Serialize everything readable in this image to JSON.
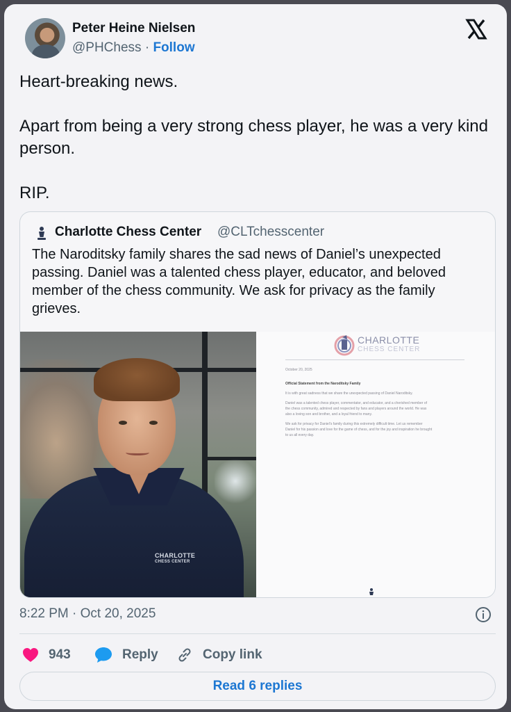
{
  "author": {
    "name": "Peter Heine Nielsen",
    "handle": "@PHChess",
    "separator": "·",
    "follow_label": "Follow"
  },
  "tweet": {
    "paragraphs": [
      "Heart-breaking news.",
      "Apart from being a very strong chess player, he was a very kind person.",
      "RIP."
    ],
    "timestamp": "8:22 PM · Oct 20, 2025"
  },
  "quote": {
    "name": "Charlotte Chess Center",
    "handle": "@CLTchesscenter",
    "text": "The Naroditsky family shares the sad news of Daniel’s unexpected passing. Daniel was a talented chess player, educator, and beloved member of the chess community. We ask for privacy as the family grieves.",
    "shirt_logo": [
      "CHARLOTTE",
      "CHESS CENTER"
    ],
    "document": {
      "logo_line1": "CHARLOTTE",
      "logo_line2": "CHESS CENTER",
      "date": "October 20, 2025",
      "heading": "Official Statement from the Naroditsky Family",
      "lines": [
        "It is with great sadness that we share the unexpected passing of Daniel Naroditsky.",
        "Daniel was a talented chess player, commentator, and educator, and a cherished member of",
        "the chess community, admired and respected by fans and players around the world. He was",
        "also a loving son and brother, and a loyal friend to many.",
        "We ask for privacy for Daniel’s family during this extremely difficult time. Let us remember",
        "Daniel for his passion and love for the game of chess, and for the joy and inspiration he brought",
        "to us all every day."
      ]
    }
  },
  "actions": {
    "likes": "943",
    "reply_label": "Reply",
    "copy_label": "Copy link",
    "read_replies_label": "Read 6 replies"
  },
  "colors": {
    "accent": "#1d77d2",
    "like": "#f91880",
    "muted": "#536471",
    "text": "#0f1419"
  },
  "icons": [
    "x-logo-icon",
    "chess-logo-icon",
    "info-icon",
    "heart-icon",
    "reply-bubble-icon",
    "link-icon"
  ]
}
